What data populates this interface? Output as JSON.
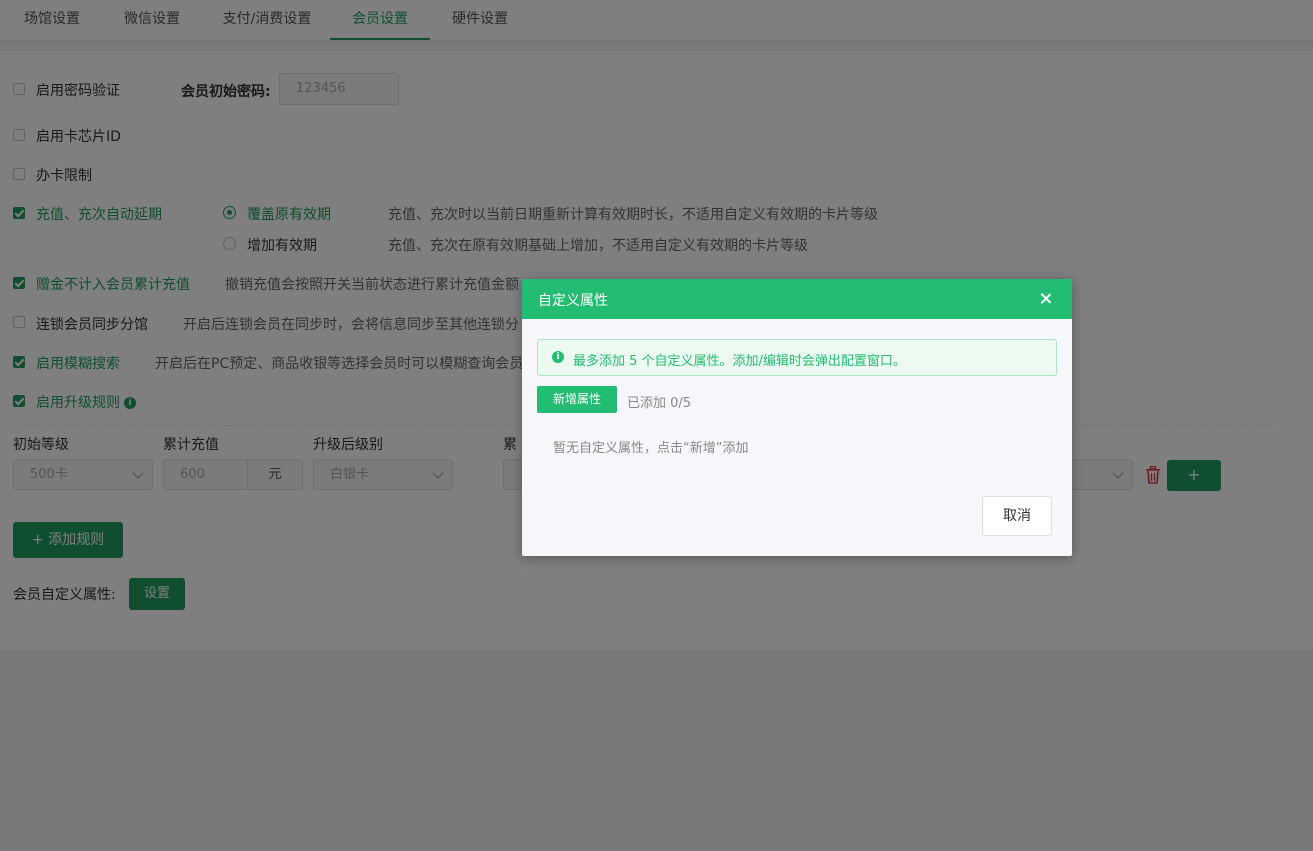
{
  "tabs": [
    "场馆设置",
    "微信设置",
    "支付/消费设置",
    "会员设置",
    "硬件设置"
  ],
  "settings": {
    "password_verify": {
      "label": "启用密码验证",
      "checked": false
    },
    "initial_password_label": "会员初始密码:",
    "initial_password_value": "123456",
    "chip_id": {
      "label": "启用卡芯片ID",
      "checked": false
    },
    "card_limit": {
      "label": "办卡限制",
      "checked": false
    },
    "auto_extend": {
      "label": "充值、充次自动延期",
      "checked": true
    },
    "radio_cover": {
      "label": "覆盖原有效期",
      "desc": "充值、充次时以当前日期重新计算有效期时长，不适用自定义有效期的卡片等级"
    },
    "radio_add": {
      "label": "增加有效期",
      "desc": "充值、充次在原有效期基础上增加，不适用自定义有效期的卡片等级"
    },
    "bonus_not_counted": {
      "label": "赠金不计入会员累计充值",
      "desc": "撤销充值会按照开关当前状态进行累计充值金额"
    },
    "chain_sync": {
      "label": "连锁会员同步分馆",
      "desc": "开启后连锁会员在同步时，会将信息同步至其他连锁分"
    },
    "fuzzy_search": {
      "label": "启用模糊搜索",
      "desc": "开启后在PC预定、商品收银等选择会员时可以模糊查询会员"
    },
    "upgrade_rule": {
      "label": "启用升级规则",
      "info_icon": "i"
    }
  },
  "rule_table": {
    "headers": [
      "初始等级",
      "累计充值",
      "升级后级别",
      "累"
    ],
    "initial_level": "500卡",
    "recharge": "600",
    "recharge_unit": "元",
    "upgrade_level": "白银卡",
    "partial_field": " ",
    "plus_label": "+"
  },
  "add_rule_label": "+ 添加规则",
  "custom_attr_label": "会员自定义属性:",
  "custom_attr_button": "设置",
  "dialog": {
    "title": "自定义属性",
    "notice_icon": "i",
    "notice": "最多添加 5 个自定义属性。添加/编辑时会弹出配置窗口。",
    "add_button": "新增属性",
    "count": "已添加 0/5",
    "empty": "暂无自定义属性，点击“新增”添加",
    "cancel": "取消"
  },
  "colors": {
    "accent": "#1e9e5e",
    "dialog_header": "#22bd72",
    "danger": "#e53935"
  }
}
